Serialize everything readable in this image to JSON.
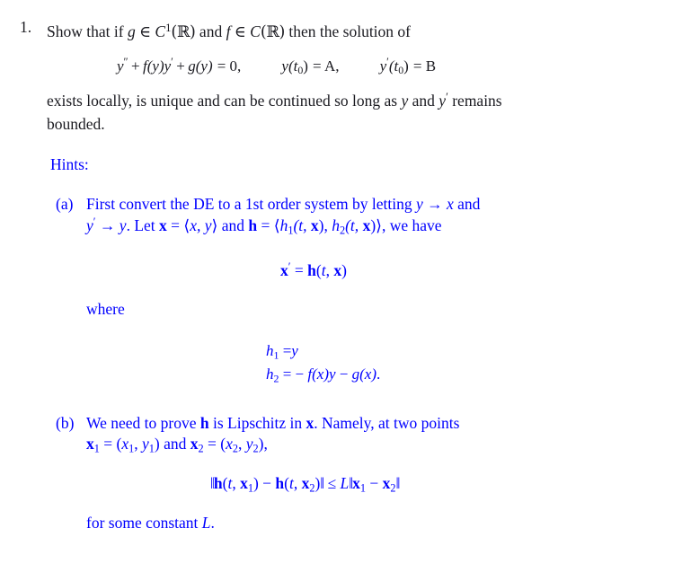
{
  "document": {
    "type": "math-homework-problem",
    "text_color": "#1a1a20",
    "hint_color": "#0000ff",
    "background": "#ffffff"
  },
  "problem": {
    "number": "1.",
    "statement_line_1_pre": "Show that if ",
    "g": "g",
    "in_1": " ∈ ",
    "C1": "C",
    "C1_sup": "1",
    "R1": "(ℝ)",
    "and": " and ",
    "f": "f",
    "in_2": " ∈ ",
    "C2": "C",
    "R2": "(ℝ)",
    "statement_line_1_post": " then the solution of",
    "equation": {
      "term_y2": "y",
      "term_y2_sup": "″",
      "plus_1": "+",
      "f_of_y": "f(y)",
      "y_prime": "y",
      "y_prime_sup": "′",
      "plus_2": "+",
      "g_of_y": "g(y)",
      "equals_zero": "= 0,",
      "ic1_y": "y",
      "ic1_arg": "(t",
      "ic1_sub": "0",
      "ic1_close": ")",
      "ic1_eq": "= A,",
      "ic2_y": "y",
      "ic2_sup": "′",
      "ic2_arg": "(t",
      "ic2_sub": "0",
      "ic2_close": ")",
      "ic2_eq": "= B"
    },
    "conclusion_pre": "exists locally, is unique and can be continued so long as ",
    "conclusion_y": "y",
    "conclusion_mid": " and ",
    "conclusion_yprime": "y",
    "conclusion_yprime_sup": "′",
    "conclusion_post": " remains",
    "conclusion_line_2": "bounded."
  },
  "hints": {
    "label": "Hints:",
    "items": [
      {
        "marker": "(a)",
        "line_1_pre": "First convert the DE to a 1st order system by letting ",
        "line_1_y": "y",
        "line_1_arrow": " → ",
        "line_1_x": "x",
        "line_1_post": " and",
        "line_2_yprime": "y",
        "line_2_yprime_sup": "′",
        "line_2_arrow": " → ",
        "line_2_y": "y",
        "line_2_let": ". Let ",
        "line_2_xbold": "x",
        "line_2_eq1": " = ⟨",
        "line_2_xy": "x, y",
        "line_2_close1": "⟩ and ",
        "line_2_hbold": "h",
        "line_2_eq2": " = ⟨",
        "line_2_h1": "h",
        "line_2_h1_sub": "1",
        "line_2_h1_args": "(t, ",
        "line_2_h1_x": "x",
        "line_2_h1_close": "), ",
        "line_2_h2": "h",
        "line_2_h2_sub": "2",
        "line_2_h2_args": "(t, ",
        "line_2_h2_x": "x",
        "line_2_h2_close": ")⟩",
        "line_2_post": ", we have"
      },
      {
        "marker": "(b)",
        "line_1_pre": "We need to prove ",
        "line_1_h": "h",
        "line_1_mid": " is Lipschitz in ",
        "line_1_x": "x",
        "line_1_post": ".  Namely, at two points",
        "line_2_x1": "x",
        "line_2_x1_sub": "1",
        "line_2_eq1": " = (",
        "line_2_x1_comp": "x",
        "line_2_x1_comp_sub": "1",
        "line_2_comma1": ", ",
        "line_2_y1_comp": "y",
        "line_2_y1_comp_sub": "1",
        "line_2_close1": ") and ",
        "line_2_x2": "x",
        "line_2_x2_sub": "2",
        "line_2_eq2": " = (",
        "line_2_x2_comp": "x",
        "line_2_x2_comp_sub": "2",
        "line_2_comma2": ", ",
        "line_2_y2_comp": "y",
        "line_2_y2_comp_sub": "2",
        "line_2_close2": "),"
      }
    ],
    "system_equation": {
      "x_bold": "x",
      "x_prime": "′",
      "equals": " = ",
      "h_bold": "h",
      "args_open": "(",
      "t": "t",
      "comma": ", ",
      "x_arg": "x",
      "args_close": ")"
    },
    "where_label": "where",
    "components": {
      "h1_name": "h",
      "h1_sub": "1",
      "h1_eq": " =",
      "h1_value": "y",
      "h2_name": "h",
      "h2_sub": "2",
      "h2_eq": " = − ",
      "h2_f": "f(x)",
      "h2_y": "y",
      "h2_minus": " − ",
      "h2_g": "g(x)",
      "h2_period": "."
    },
    "lipschitz_inequality": {
      "norm_open_1": "‖",
      "h_1": "h",
      "h_1_args_open": "(",
      "h_1_t": "t",
      "h_1_comma": ", ",
      "h_1_x": "x",
      "h_1_sub": "1",
      "h_1_args_close": ")",
      "minus": " − ",
      "h_2": "h",
      "h_2_args_open": "(",
      "h_2_t": "t",
      "h_2_comma": ", ",
      "h_2_x": "x",
      "h_2_sub": "2",
      "h_2_args_close": ")",
      "norm_close_1": "‖",
      "leq": " ≤ ",
      "L": "L",
      "norm_open_2": "‖",
      "rhs_x1": "x",
      "rhs_x1_sub": "1",
      "rhs_minus": " − ",
      "rhs_x2": "x",
      "rhs_x2_sub": "2",
      "norm_close_2": "‖"
    },
    "closing_pre": "for some constant ",
    "closing_L": "L",
    "closing_post": "."
  }
}
